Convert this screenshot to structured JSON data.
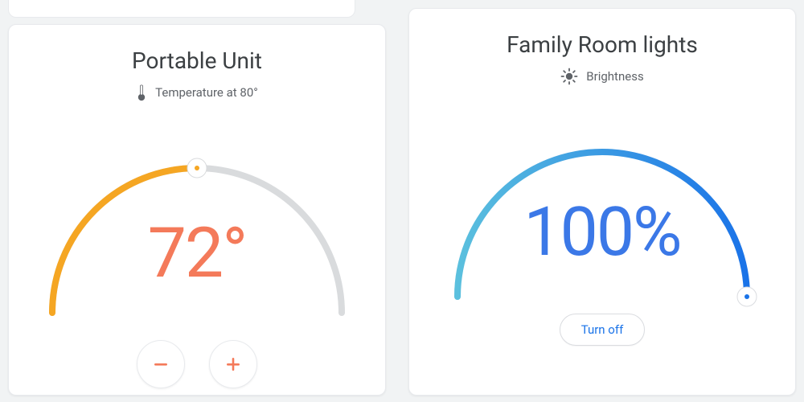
{
  "thermostat": {
    "title": "Portable Unit",
    "status_label": "Temperature at 80°",
    "setpoint_display": "72°",
    "setpoint_value": 72,
    "current_temp": 80,
    "arc_fill_fraction": 0.5,
    "icons": {
      "thermometer": "thermometer-icon",
      "minus": "minus-icon",
      "plus": "plus-icon"
    },
    "colors": {
      "arc_active": "#f5a623",
      "arc_inactive": "#d9dbdd",
      "value": "#f47a5a"
    }
  },
  "lights": {
    "title": "Family Room lights",
    "sub_label": "Brightness",
    "brightness_display": "100%",
    "brightness_value": 100,
    "arc_fill_fraction": 1.0,
    "turn_off_label": "Turn off",
    "icons": {
      "brightness": "brightness-icon"
    },
    "colors": {
      "arc_start": "#5bc0de",
      "arc_end": "#1a73e8",
      "value": "#3b78e7"
    }
  }
}
